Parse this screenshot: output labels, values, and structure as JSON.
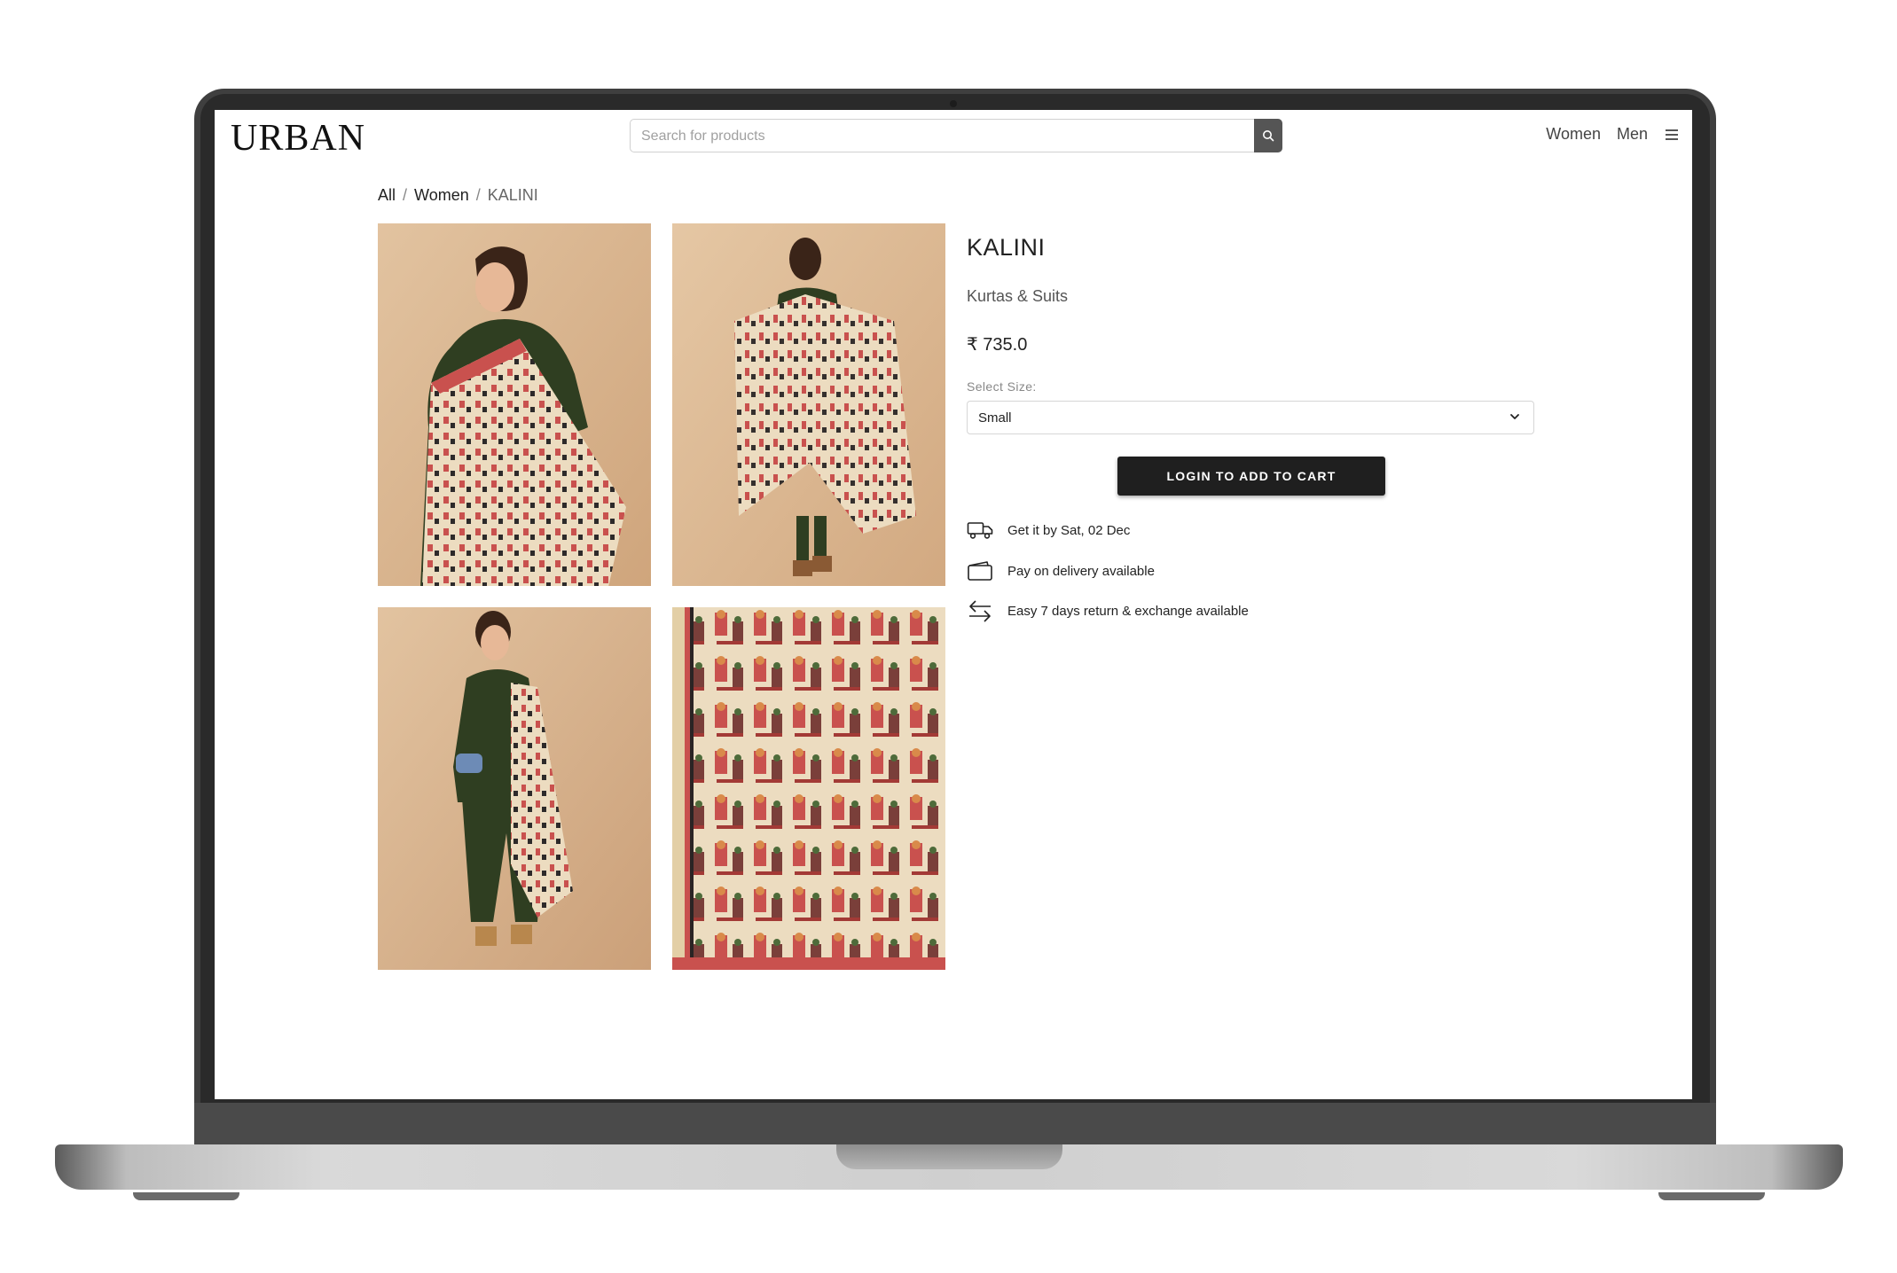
{
  "header": {
    "logo": "URBAN",
    "search_placeholder": "Search for products",
    "nav": [
      "Women",
      "Men"
    ]
  },
  "breadcrumb": [
    "All",
    "Women",
    "KALINI"
  ],
  "product": {
    "title": "KALINI",
    "category": "Kurtas & Suits",
    "price": "₹ 735.0",
    "size_label": "Select Size:",
    "size_selected": "Small",
    "cart_button": "LOGIN TO ADD TO CART",
    "info": [
      {
        "icon": "delivery-truck-icon",
        "text": "Get it by Sat, 02 Dec"
      },
      {
        "icon": "wallet-icon",
        "text": "Pay on delivery available"
      },
      {
        "icon": "exchange-arrows-icon",
        "text": "Easy 7 days return & exchange available"
      }
    ]
  },
  "gallery": [
    {
      "name": "product-image-front"
    },
    {
      "name": "product-image-back"
    },
    {
      "name": "product-image-full"
    },
    {
      "name": "product-image-fabric-detail"
    }
  ],
  "colors": {
    "button": "#1f1f1f",
    "search_button": "#555555",
    "photo_background": "#d8b48f",
    "kurta": "#2f3e21",
    "dupatta_red": "#c9514e",
    "dupatta_cream": "#ecdcc0"
  }
}
